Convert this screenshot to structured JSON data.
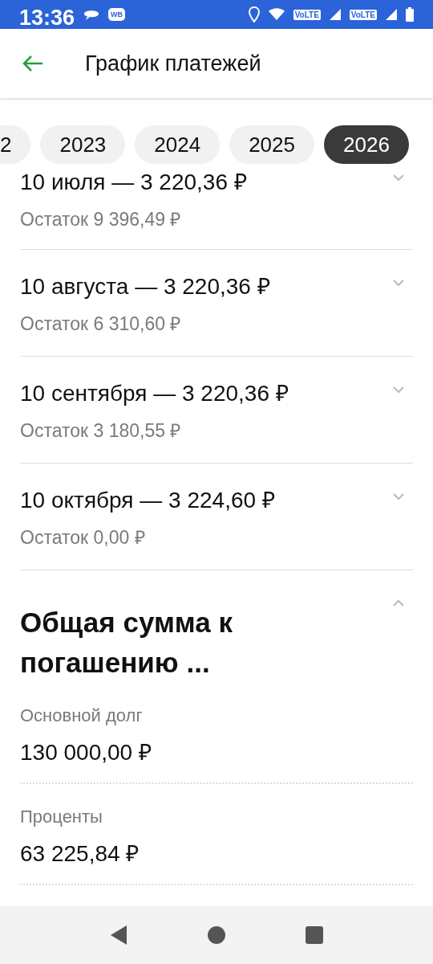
{
  "status_bar": {
    "time": "13:36",
    "badge": "WB",
    "network_labels": [
      "VoLTE",
      "VoLTE"
    ]
  },
  "header": {
    "title": "График платежей"
  },
  "year_tabs": [
    {
      "label": "2",
      "selected": false
    },
    {
      "label": "2023",
      "selected": false
    },
    {
      "label": "2024",
      "selected": false
    },
    {
      "label": "2025",
      "selected": false
    },
    {
      "label": "2026",
      "selected": true
    }
  ],
  "payments": [
    {
      "title": "10 июля — 3 220,36 ₽",
      "balance": "Остаток 9 396,49 ₽",
      "expanded": false,
      "partial": true
    },
    {
      "title": "10 августа — 3 220,36 ₽",
      "balance": "Остаток 6 310,60 ₽",
      "expanded": false,
      "partial": false
    },
    {
      "title": "10 сентября — 3 220,36 ₽",
      "balance": "Остаток 3 180,55 ₽",
      "expanded": false,
      "partial": false
    },
    {
      "title": "10 октября — 3 224,60 ₽",
      "balance": "Остаток 0,00 ₽",
      "expanded": false,
      "partial": false
    }
  ],
  "summary": {
    "title": "Общая сумма к погашению ...",
    "expanded": true,
    "items": [
      {
        "label": "Основной долг",
        "value": "130 000,00 ₽"
      },
      {
        "label": "Проценты",
        "value": "63 225,84 ₽"
      }
    ]
  }
}
